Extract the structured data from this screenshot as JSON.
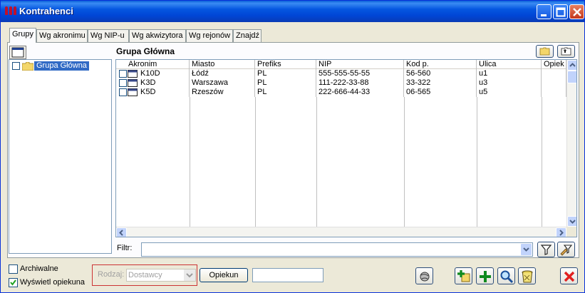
{
  "window": {
    "title": "Kontrahenci",
    "title_color": "#ffffff",
    "titlebar_color": "#0054e3"
  },
  "tabs": [
    {
      "label": "Grupy",
      "active": true
    },
    {
      "label": "Wg akronimu",
      "active": false
    },
    {
      "label": "Wg NIP-u",
      "active": false
    },
    {
      "label": "Wg akwizytora",
      "active": false
    },
    {
      "label": "Wg rejonów",
      "active": false
    },
    {
      "label": "Znajdź",
      "active": false
    }
  ],
  "tree": {
    "items": [
      {
        "label": "Grupa Główna",
        "selected": true
      }
    ]
  },
  "group_title": "Grupa Główna",
  "table": {
    "columns": [
      "Akronim",
      "Miasto",
      "Prefiks",
      "NIP",
      "Kod p.",
      "Ulica",
      "Opiek"
    ],
    "rows": [
      {
        "akronim": "K10D",
        "miasto": "Łódź",
        "prefiks": "PL",
        "nip": "555-555-55-55",
        "kod": "56-560",
        "ulica": "u1"
      },
      {
        "akronim": "K3D",
        "miasto": "Warszawa",
        "prefiks": "PL",
        "nip": "111-222-33-88",
        "kod": "33-322",
        "ulica": "u3"
      },
      {
        "akronim": "K5D",
        "miasto": "Rzeszów",
        "prefiks": "PL",
        "nip": "222-666-44-33",
        "kod": "06-565",
        "ulica": "u5"
      }
    ]
  },
  "filter": {
    "label": "Filtr:",
    "value": ""
  },
  "bottom": {
    "archiwalne_label": "Archiwalne",
    "archiwalne_checked": false,
    "wyswietl_label": "Wyświetl opiekuna",
    "wyswietl_checked": true,
    "rodzaj_label": "Rodzaj:",
    "rodzaj_value": "Dostawcy",
    "opiekun_label": "Opiekun",
    "opiekun_value": ""
  },
  "icons": {
    "tree_toggle": "panel-icon",
    "folder": "folder-icon",
    "folder_up": "folder-up-icon",
    "filter": "funnel-icon",
    "filter_settings": "funnel-settings-icon",
    "report": "globe-icon",
    "add_copy": "add-copy-icon",
    "add": "plus-icon",
    "search": "magnifier-icon",
    "delete": "trash-icon",
    "close": "red-x-icon"
  }
}
